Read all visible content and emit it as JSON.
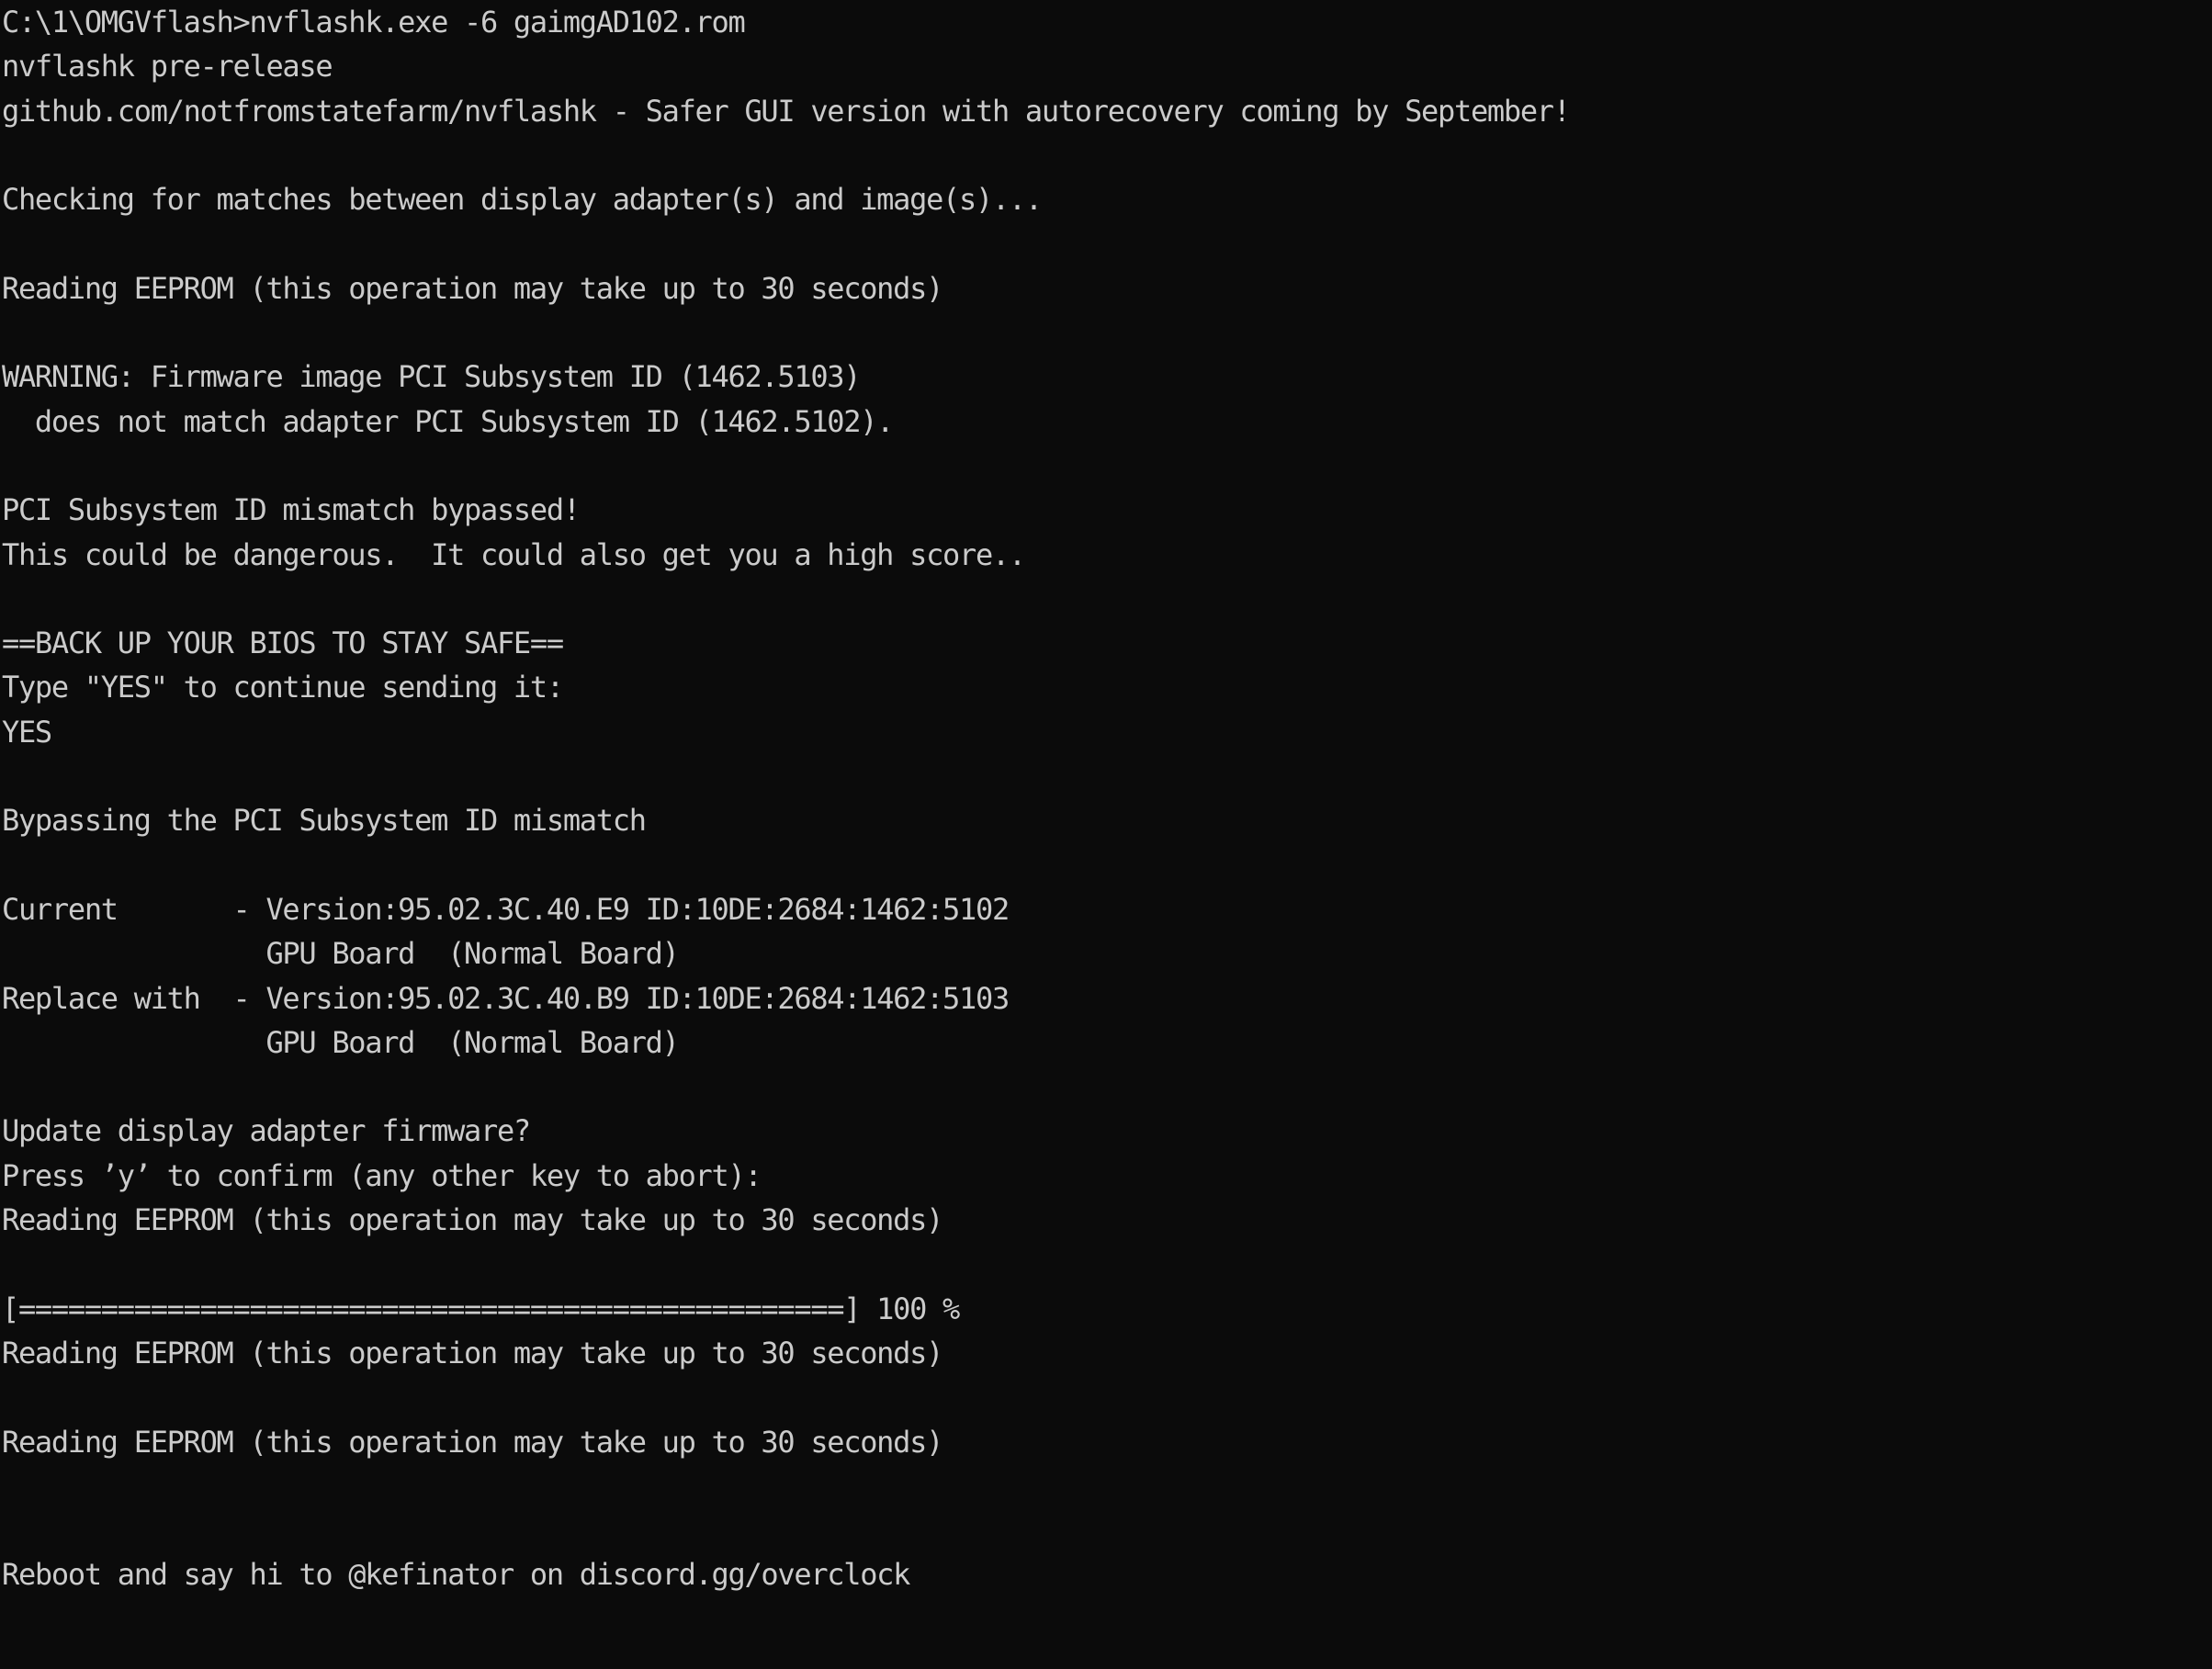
{
  "terminal": {
    "name": "windows-console",
    "background_color": "#0b0b0b",
    "foreground_color": "#cccccc",
    "columns": 80,
    "prompt_path": "C:\\1\\OMGVflash",
    "command": "nvflashk.exe -6 gaimgAD102.rom",
    "lines": [
      "C:\\1\\OMGVflash>nvflashk.exe -6 gaimgAD102.rom",
      "nvflashk pre-release",
      "github.com/notfromstatefarm/nvflashk - Safer GUI version with autorecovery coming by September!",
      "",
      "Checking for matches between display adapter(s) and image(s)...",
      "",
      "Reading EEPROM (this operation may take up to 30 seconds)",
      "",
      "WARNING: Firmware image PCI Subsystem ID (1462.5103)",
      "  does not match adapter PCI Subsystem ID (1462.5102).",
      "",
      "PCI Subsystem ID mismatch bypassed!",
      "This could be dangerous.  It could also get you a high score..",
      "",
      "==BACK UP YOUR BIOS TO STAY SAFE==",
      "Type \"YES\" to continue sending it:",
      "YES",
      "",
      "Bypassing the PCI Subsystem ID mismatch",
      "",
      "Current       - Version:95.02.3C.40.E9 ID:10DE:2684:1462:5102",
      "                GPU Board  (Normal Board)",
      "Replace with  - Version:95.02.3C.40.B9 ID:10DE:2684:1462:5103",
      "                GPU Board  (Normal Board)",
      "",
      "Update display adapter firmware?",
      "Press ’y’ to confirm (any other key to abort):",
      "Reading EEPROM (this operation may take up to 30 seconds)",
      "",
      "[==================================================] 100 %",
      "Reading EEPROM (this operation may take up to 30 seconds)",
      "",
      "Reading EEPROM (this operation may take up to 30 seconds)",
      "",
      "",
      "Reboot and say hi to @kefinator on discord.gg/overclock",
      ""
    ],
    "details": {
      "tool_name": "nvflashk",
      "tool_status": "pre-release",
      "project_url": "github.com/notfromstatefarm/nvflashk",
      "project_note": "Safer GUI version with autorecovery coming by September!",
      "warning_image_subsystem_id": "1462.5103",
      "warning_adapter_subsystem_id": "1462.5102",
      "bypass_message": "PCI Subsystem ID mismatch bypassed!",
      "danger_message": "This could be dangerous.  It could also get you a high score..",
      "backup_banner": "==BACK UP YOUR BIOS TO STAY SAFE==",
      "confirm_prompt": "Type \"YES\" to continue sending it:",
      "user_input": "YES",
      "current_version": "95.02.3C.40.E9",
      "current_id": "10DE:2684:1462:5102",
      "current_board": "GPU Board  (Normal Board)",
      "replace_version": "95.02.3C.40.B9",
      "replace_id": "10DE:2684:1462:5103",
      "replace_board": "GPU Board  (Normal Board)",
      "update_prompt": "Update display adapter firmware?",
      "key_prompt": "Press ’y’ to confirm (any other key to abort):",
      "eeprom_message": "Reading EEPROM (this operation may take up to 30 seconds)",
      "progress_percent": "100 %",
      "progress_fill_char": "=",
      "progress_fill_count": 50,
      "closing_message": "Reboot and say hi to @kefinator on discord.gg/overclock"
    }
  }
}
